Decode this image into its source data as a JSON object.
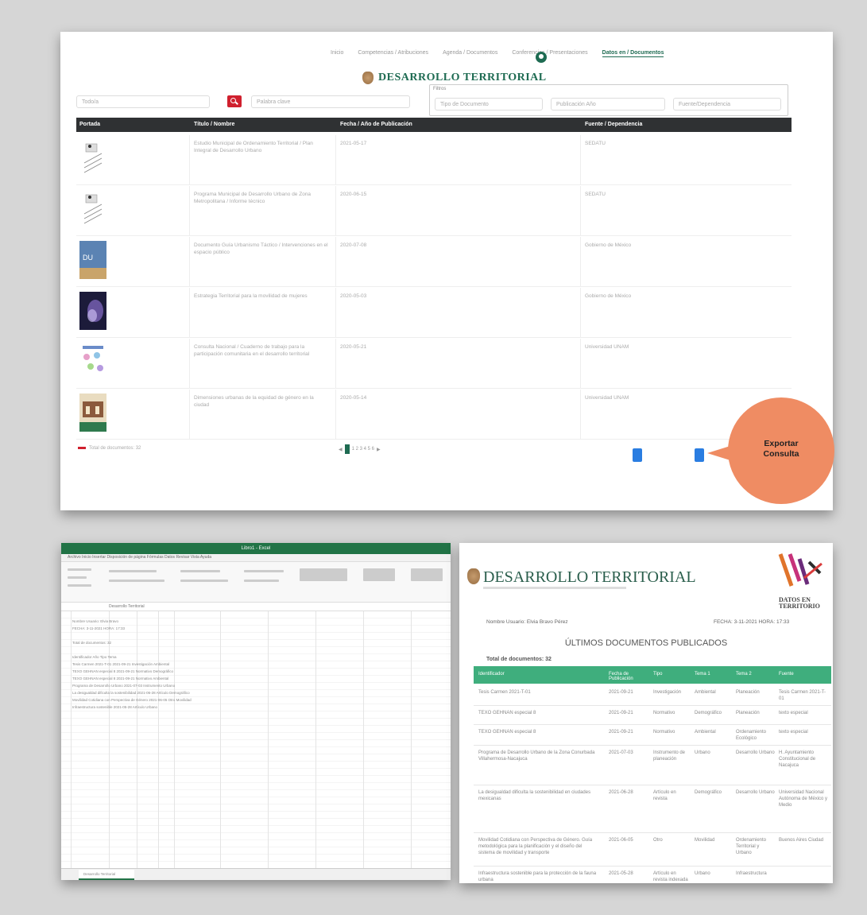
{
  "nav": {
    "items": [
      "Inicio",
      "Competencias / Atribuciones",
      "Agenda / Documentos",
      "Conferencias / Presentaciones",
      "Datos en / Documentos"
    ],
    "active_index": 4
  },
  "brand": {
    "title": "DESARROLLO TERRITORIAL"
  },
  "search": {
    "select_placeholder": "Todo/a",
    "input_placeholder": "Palabra clave"
  },
  "filters": {
    "label": "Filtros",
    "fields": [
      "Tipo de Documento",
      "Publicación Año",
      "Fuente/Dependencia"
    ]
  },
  "table": {
    "columns": [
      "Portada",
      "Título / Nombre",
      "Fecha / Año de Publicación",
      "Fuente / Dependencia"
    ],
    "rows": [
      {
        "title": "Estudio Municipal de Ordenamiento Territorial / Plan Integral de Desarrollo Urbano",
        "date": "2021-05-17",
        "source": "SEDATU"
      },
      {
        "title": "Programa Municipal de Desarrollo Urbano de Zona Metropolitana / Informe técnico",
        "date": "2020-06-15",
        "source": "SEDATU"
      },
      {
        "title": "Documento Guía Urbanismo Táctico / Intervenciones en el espacio público",
        "date": "2020-07-08",
        "source": "Gobierno de México"
      },
      {
        "title": "Estrategia Territorial para la movilidad de mujeres",
        "date": "2020-05-03",
        "source": "Gobierno de México"
      },
      {
        "title": "Consulta Nacional / Cuaderno de trabajo para la participación comunitaria en el desarrollo territorial",
        "date": "2020-05-21",
        "source": "Universidad UNAM"
      },
      {
        "title": "Dimensiones urbanas de la equidad de género en la ciudad",
        "date": "2020-05-14",
        "source": "Universidad UNAM"
      }
    ]
  },
  "footer": {
    "total": "Total de documentos: 32",
    "pages": "1  2  3  4  5  6"
  },
  "callout": {
    "line1": "Exportar",
    "line2": "Consulta",
    "color": "#ef8c63"
  },
  "excel": {
    "title": "Libro1 - Excel",
    "menu": "Archivo   Inicio   Insertar   Disposición de página   Fórmulas   Datos   Revisar   Vista   Ayuda",
    "formula": "Desarrollo Territorial",
    "sheet_tab": "Desarrollo Territorial",
    "cells": [
      "Nombre Usuario: Elvia Bravo",
      "FECHA: 3-11-2021  HORA: 17:33",
      "Total de documentos: 32",
      "Identificador   Año   Tipo   Tema",
      "Tesis Carmen 2021-T-01   2021-09-21   Investigación   Ambiental",
      "TEXO GEHNAN especial 8   2021-09-21   Normativo   Demográfico",
      "TEXO GEHNAN especial 8   2021-09-21   Normativo   Ambiental",
      "Programa de Desarrollo Urbano   2021-07-03   Instrumento   Urbano",
      "La desigualdad dificulta la sostenibilidad   2021-06-28   Artículo   Demográfico",
      "Movilidad Cotidiana con Perspectiva de Género   2021-06-05   Otro   Movilidad",
      "Infraestructura sostenible   2021-05-28   Artículo   Urbano"
    ]
  },
  "report": {
    "title": "DESARROLLO TERRITORIAL",
    "logo_text": "DATOS EN TERRITORIO",
    "user": "Nombre Usuario: Elvia Bravo Pérez",
    "date": "FECHA: 3-11-2021   HORA: 17:33",
    "heading": "ÚLTIMOS DOCUMENTOS PUBLICADOS",
    "total": "Total de documentos: 32",
    "columns": [
      "Identificador",
      "Fecha de Publicación",
      "Tipo",
      "Tema 1",
      "Tema 2",
      "Fuente"
    ],
    "rows": [
      {
        "id": "Tesis Carmen 2021-T-01",
        "date": "2021-09-21",
        "type": "Investigación",
        "t1": "Ambiental",
        "t2": "Planeación",
        "src": "Tesis Carmen 2021-T-01"
      },
      {
        "id": "TEXO GEHNAN especial 8",
        "date": "2021-09-21",
        "type": "Normativo",
        "t1": "Demográfico",
        "t2": "Planeación",
        "src": "texto especial"
      },
      {
        "id": "TEXO GEHNAN especial 8",
        "date": "2021-09-21",
        "type": "Normativo",
        "t1": "Ambiental",
        "t2": "Ordenamiento Ecológico",
        "src": "texto especial"
      },
      {
        "id": "Programa de Desarrollo Urbano de la Zona Conurbada Villahermosa-Nacajuca",
        "date": "2021-07-03",
        "type": "Instrumento de planeación",
        "t1": "Urbano",
        "t2": "Desarrollo Urbano",
        "src": "H. Ayuntamiento Constitucional de Nacajuca"
      },
      {
        "id": "La desigualdad dificulta la sostenibilidad en ciudades mexicanas",
        "date": "2021-06-28",
        "type": "Artículo en revista",
        "t1": "Demográfico",
        "t2": "Desarrollo Urbano",
        "src": "Universidad Nacional Autónoma de México y Medio"
      },
      {
        "id": "Movilidad Cotidiana con Perspectiva de Género. Guía metodológica para la planificación y el diseño del sistema de movilidad y transporte",
        "date": "2021-06-05",
        "type": "Otro",
        "t1": "Movilidad",
        "t2": "Ordenamiento Territorial y Urbano",
        "src": "Buenos Aires Ciudad"
      },
      {
        "id": "Infraestructura sostenible para la protección de la fauna urbana",
        "date": "2021-05-28",
        "type": "Artículo en revista indexada",
        "t1": "Urbano",
        "t2": "Infraestructura",
        "src": ""
      }
    ]
  }
}
